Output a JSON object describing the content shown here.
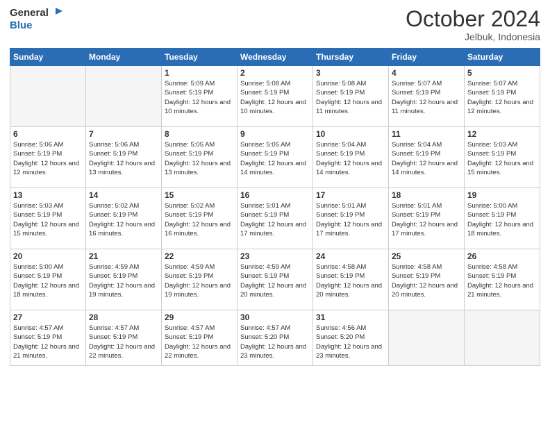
{
  "logo": {
    "general": "General",
    "blue": "Blue"
  },
  "header": {
    "month": "October 2024",
    "location": "Jelbuk, Indonesia"
  },
  "weekdays": [
    "Sunday",
    "Monday",
    "Tuesday",
    "Wednesday",
    "Thursday",
    "Friday",
    "Saturday"
  ],
  "weeks": [
    [
      {
        "day": "",
        "info": ""
      },
      {
        "day": "",
        "info": ""
      },
      {
        "day": "1",
        "info": "Sunrise: 5:09 AM\nSunset: 5:19 PM\nDaylight: 12 hours and 10 minutes."
      },
      {
        "day": "2",
        "info": "Sunrise: 5:08 AM\nSunset: 5:19 PM\nDaylight: 12 hours and 10 minutes."
      },
      {
        "day": "3",
        "info": "Sunrise: 5:08 AM\nSunset: 5:19 PM\nDaylight: 12 hours and 11 minutes."
      },
      {
        "day": "4",
        "info": "Sunrise: 5:07 AM\nSunset: 5:19 PM\nDaylight: 12 hours and 11 minutes."
      },
      {
        "day": "5",
        "info": "Sunrise: 5:07 AM\nSunset: 5:19 PM\nDaylight: 12 hours and 12 minutes."
      }
    ],
    [
      {
        "day": "6",
        "info": "Sunrise: 5:06 AM\nSunset: 5:19 PM\nDaylight: 12 hours and 12 minutes."
      },
      {
        "day": "7",
        "info": "Sunrise: 5:06 AM\nSunset: 5:19 PM\nDaylight: 12 hours and 13 minutes."
      },
      {
        "day": "8",
        "info": "Sunrise: 5:05 AM\nSunset: 5:19 PM\nDaylight: 12 hours and 13 minutes."
      },
      {
        "day": "9",
        "info": "Sunrise: 5:05 AM\nSunset: 5:19 PM\nDaylight: 12 hours and 14 minutes."
      },
      {
        "day": "10",
        "info": "Sunrise: 5:04 AM\nSunset: 5:19 PM\nDaylight: 12 hours and 14 minutes."
      },
      {
        "day": "11",
        "info": "Sunrise: 5:04 AM\nSunset: 5:19 PM\nDaylight: 12 hours and 14 minutes."
      },
      {
        "day": "12",
        "info": "Sunrise: 5:03 AM\nSunset: 5:19 PM\nDaylight: 12 hours and 15 minutes."
      }
    ],
    [
      {
        "day": "13",
        "info": "Sunrise: 5:03 AM\nSunset: 5:19 PM\nDaylight: 12 hours and 15 minutes."
      },
      {
        "day": "14",
        "info": "Sunrise: 5:02 AM\nSunset: 5:19 PM\nDaylight: 12 hours and 16 minutes."
      },
      {
        "day": "15",
        "info": "Sunrise: 5:02 AM\nSunset: 5:19 PM\nDaylight: 12 hours and 16 minutes."
      },
      {
        "day": "16",
        "info": "Sunrise: 5:01 AM\nSunset: 5:19 PM\nDaylight: 12 hours and 17 minutes."
      },
      {
        "day": "17",
        "info": "Sunrise: 5:01 AM\nSunset: 5:19 PM\nDaylight: 12 hours and 17 minutes."
      },
      {
        "day": "18",
        "info": "Sunrise: 5:01 AM\nSunset: 5:19 PM\nDaylight: 12 hours and 17 minutes."
      },
      {
        "day": "19",
        "info": "Sunrise: 5:00 AM\nSunset: 5:19 PM\nDaylight: 12 hours and 18 minutes."
      }
    ],
    [
      {
        "day": "20",
        "info": "Sunrise: 5:00 AM\nSunset: 5:19 PM\nDaylight: 12 hours and 18 minutes."
      },
      {
        "day": "21",
        "info": "Sunrise: 4:59 AM\nSunset: 5:19 PM\nDaylight: 12 hours and 19 minutes."
      },
      {
        "day": "22",
        "info": "Sunrise: 4:59 AM\nSunset: 5:19 PM\nDaylight: 12 hours and 19 minutes."
      },
      {
        "day": "23",
        "info": "Sunrise: 4:59 AM\nSunset: 5:19 PM\nDaylight: 12 hours and 20 minutes."
      },
      {
        "day": "24",
        "info": "Sunrise: 4:58 AM\nSunset: 5:19 PM\nDaylight: 12 hours and 20 minutes."
      },
      {
        "day": "25",
        "info": "Sunrise: 4:58 AM\nSunset: 5:19 PM\nDaylight: 12 hours and 20 minutes."
      },
      {
        "day": "26",
        "info": "Sunrise: 4:58 AM\nSunset: 5:19 PM\nDaylight: 12 hours and 21 minutes."
      }
    ],
    [
      {
        "day": "27",
        "info": "Sunrise: 4:57 AM\nSunset: 5:19 PM\nDaylight: 12 hours and 21 minutes."
      },
      {
        "day": "28",
        "info": "Sunrise: 4:57 AM\nSunset: 5:19 PM\nDaylight: 12 hours and 22 minutes."
      },
      {
        "day": "29",
        "info": "Sunrise: 4:57 AM\nSunset: 5:19 PM\nDaylight: 12 hours and 22 minutes."
      },
      {
        "day": "30",
        "info": "Sunrise: 4:57 AM\nSunset: 5:20 PM\nDaylight: 12 hours and 23 minutes."
      },
      {
        "day": "31",
        "info": "Sunrise: 4:56 AM\nSunset: 5:20 PM\nDaylight: 12 hours and 23 minutes."
      },
      {
        "day": "",
        "info": ""
      },
      {
        "day": "",
        "info": ""
      }
    ]
  ]
}
